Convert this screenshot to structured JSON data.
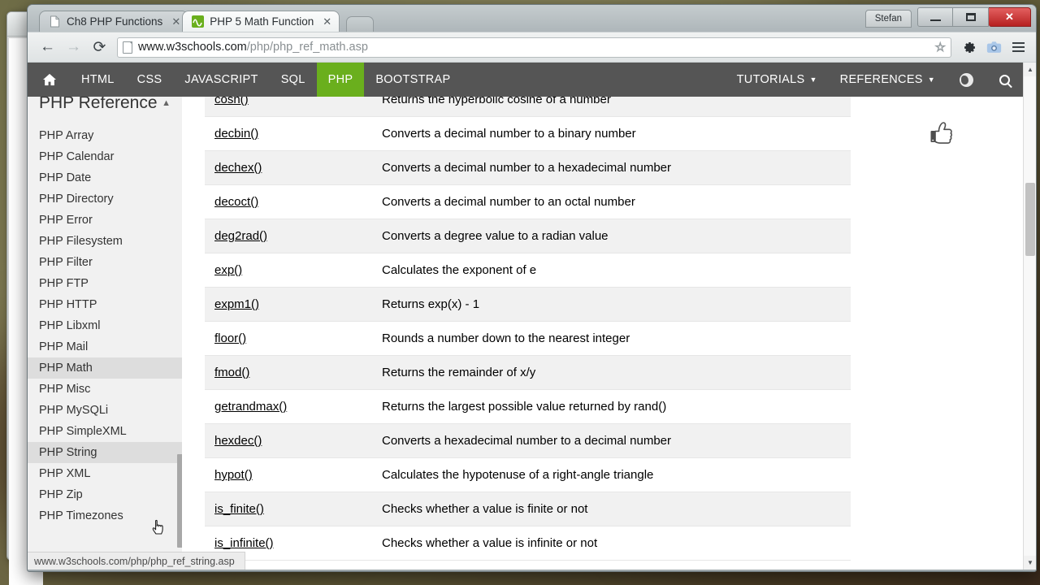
{
  "window": {
    "user_label": "Stefan",
    "minimize_label": "—",
    "maximize_label": "❑",
    "close_label": "✕"
  },
  "tabs": [
    {
      "title": "Ch8 PHP Functions",
      "close": "✕",
      "favicon": "document-icon",
      "active": false
    },
    {
      "title": "PHP 5 Math Function",
      "close": "✕",
      "favicon": "w3schools-icon",
      "active": true
    }
  ],
  "toolbar": {
    "back": "←",
    "forward": "→",
    "reload": "⟳",
    "url_host": "www.w3schools.com",
    "url_path": "/php/php_ref_math.asp",
    "bookmark_star": "☆",
    "settings": "⚙",
    "screenshot": "📷",
    "menu": "menu-icon"
  },
  "site_nav": {
    "home": "🏠",
    "items": [
      {
        "label": "HTML",
        "active": false
      },
      {
        "label": "CSS",
        "active": false
      },
      {
        "label": "JAVASCRIPT",
        "active": false
      },
      {
        "label": "SQL",
        "active": false
      },
      {
        "label": "PHP",
        "active": true
      },
      {
        "label": "BOOTSTRAP",
        "active": false
      }
    ],
    "menus": [
      {
        "label": "TUTORIALS",
        "caret": "▼"
      },
      {
        "label": "REFERENCES",
        "caret": "▼"
      }
    ],
    "active_color": "#6aaf1d",
    "bar_color": "#555555"
  },
  "sidebar": {
    "title": "PHP Reference",
    "collapse_caret": "▲",
    "items": [
      {
        "label": "PHP Array",
        "highlighted": false
      },
      {
        "label": "PHP Calendar",
        "highlighted": false
      },
      {
        "label": "PHP Date",
        "highlighted": false
      },
      {
        "label": "PHP Directory",
        "highlighted": false
      },
      {
        "label": "PHP Error",
        "highlighted": false
      },
      {
        "label": "PHP Filesystem",
        "highlighted": false
      },
      {
        "label": "PHP Filter",
        "highlighted": false
      },
      {
        "label": "PHP FTP",
        "highlighted": false
      },
      {
        "label": "PHP HTTP",
        "highlighted": false
      },
      {
        "label": "PHP Libxml",
        "highlighted": false
      },
      {
        "label": "PHP Mail",
        "highlighted": false
      },
      {
        "label": "PHP Math",
        "highlighted": true
      },
      {
        "label": "PHP Misc",
        "highlighted": false
      },
      {
        "label": "PHP MySQLi",
        "highlighted": false
      },
      {
        "label": "PHP SimpleXML",
        "highlighted": false
      },
      {
        "label": "PHP String",
        "highlighted": true
      },
      {
        "label": "PHP XML",
        "highlighted": false
      },
      {
        "label": "PHP Zip",
        "highlighted": false
      },
      {
        "label": "PHP Timezones",
        "highlighted": false
      }
    ]
  },
  "function_table": {
    "rows": [
      {
        "name": "cosh()",
        "description": "Returns the hyperbolic cosine of a number"
      },
      {
        "name": "decbin()",
        "description": "Converts a decimal number to a binary number"
      },
      {
        "name": "dechex()",
        "description": "Converts a decimal number to a hexadecimal number"
      },
      {
        "name": "decoct()",
        "description": "Converts a decimal number to an octal number"
      },
      {
        "name": "deg2rad()",
        "description": "Converts a degree value to a radian value"
      },
      {
        "name": "exp()",
        "description": "Calculates the exponent of e"
      },
      {
        "name": "expm1()",
        "description": "Returns exp(x) - 1"
      },
      {
        "name": "floor()",
        "description": "Rounds a number down to the nearest integer"
      },
      {
        "name": "fmod()",
        "description": "Returns the remainder of x/y"
      },
      {
        "name": "getrandmax()",
        "description": "Returns the largest possible value returned by rand()"
      },
      {
        "name": "hexdec()",
        "description": "Converts a hexadecimal number to a decimal number"
      },
      {
        "name": "hypot()",
        "description": "Calculates the hypotenuse of a right-angle triangle"
      },
      {
        "name": "is_finite()",
        "description": "Checks whether a value is finite or not"
      },
      {
        "name": "is_infinite()",
        "description": "Checks whether a value is infinite or not"
      }
    ]
  },
  "rail": {
    "thumbs_up": "👍"
  },
  "status": {
    "link_url": "www.w3schools.com/php/php_ref_string.asp"
  },
  "scrollbars": {
    "up_arrow": "▲",
    "down_arrow": "▼"
  }
}
